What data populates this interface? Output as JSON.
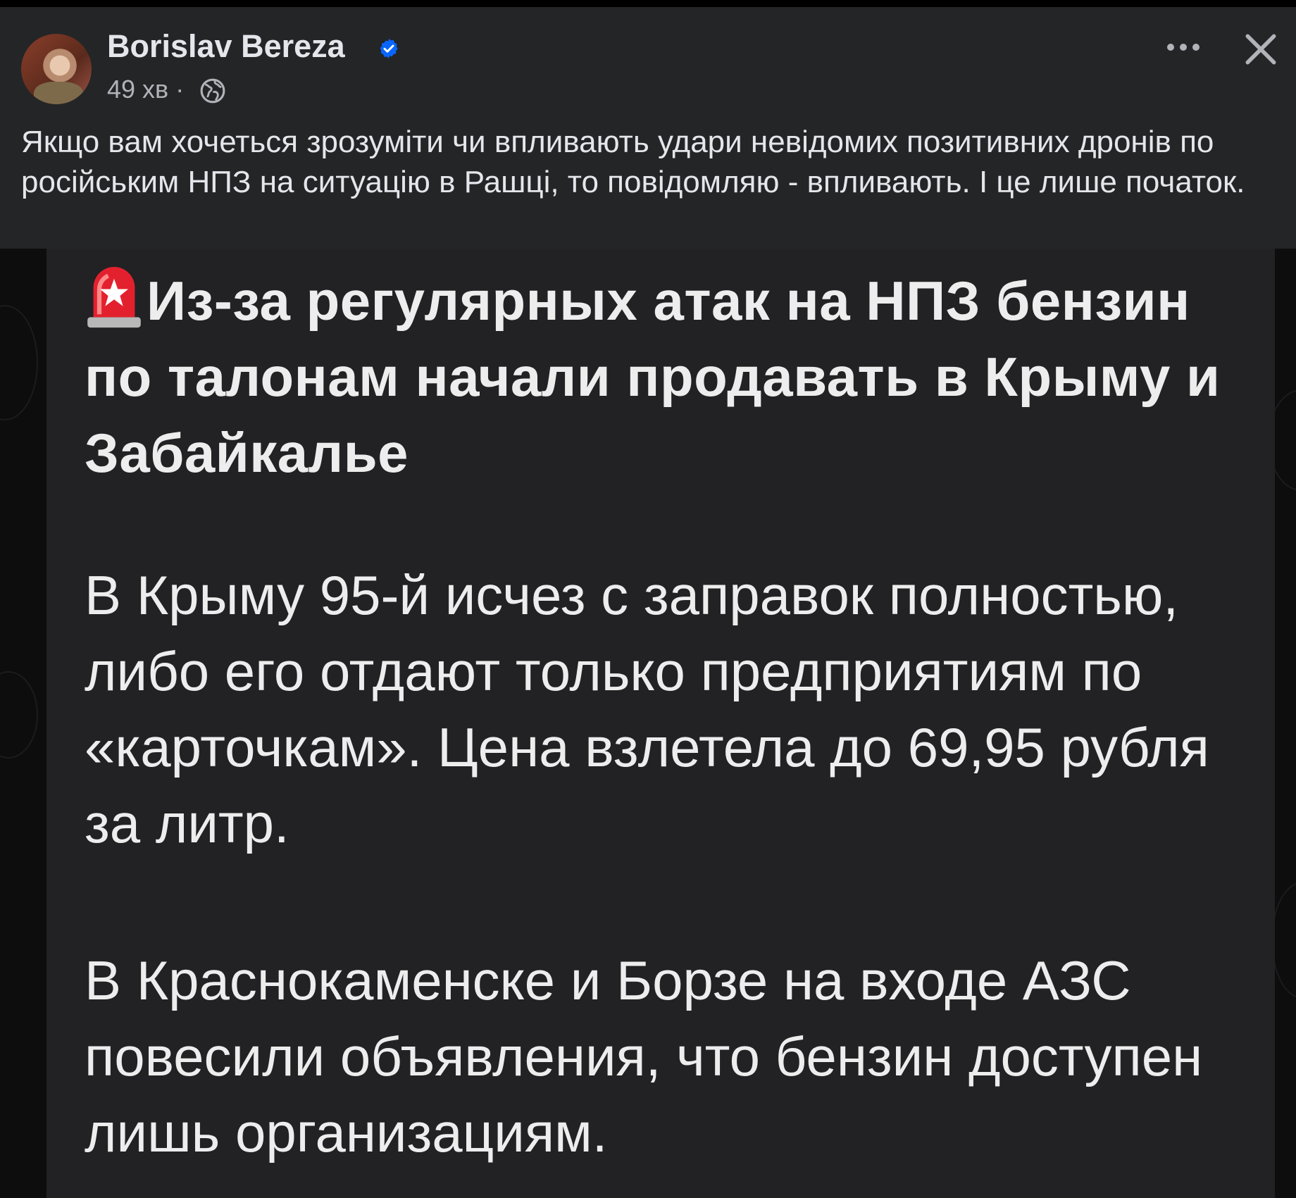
{
  "post": {
    "author": "Borislav Bereza",
    "time": "49 хв",
    "separator": "·",
    "text": "Якщо вам хочеться зрозуміти чи впливають удари невідомих позитивних дронів по російським НПЗ на ситуацію в Рашці, то повідомляю - впливають. І це лише початок."
  },
  "icons": {
    "verified": "verified-badge-icon",
    "privacy": "globe-icon",
    "more": "more-options-icon",
    "close": "close-icon",
    "siren": "siren-emoji-icon"
  },
  "image": {
    "headline": "Из-за регулярных атак на НПЗ бензин по талонам начали продавать в Крыму и Забайкалье",
    "paragraph1": "В Крыму 95-й исчез с заправок полностью, либо его отдают только предприятиям по «карточкам». Цена взлетела до 69,95 рубля за литр.",
    "paragraph2": "В Краснокаменске и Борзе на входе АЗС повесили объявления, что бензин доступен лишь организациям."
  },
  "colors": {
    "header_bg": "#242526",
    "text_primary": "#e4e6eb",
    "text_secondary": "#b0b3b8",
    "verified_blue": "#0866ff",
    "image_bg": "#222224"
  }
}
